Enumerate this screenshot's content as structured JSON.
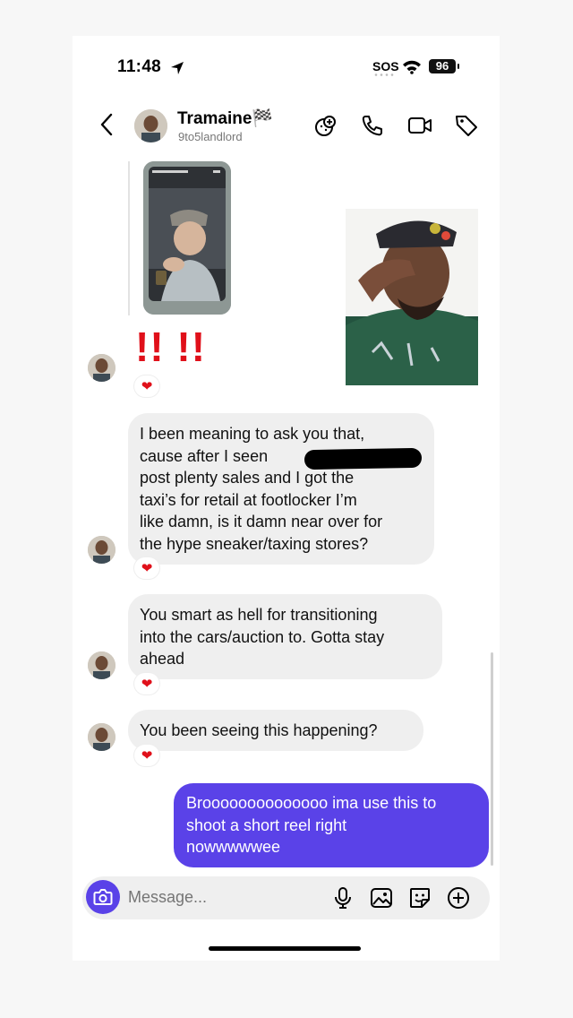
{
  "status_bar": {
    "time": "11:48",
    "sos": "SOS",
    "battery": "96"
  },
  "header": {
    "name": "Tramaine🏁",
    "username": "9to5landlord",
    "icons": [
      "back-chevron-icon",
      "call-effects-icon",
      "phone-icon",
      "video-icon",
      "tag-icon"
    ]
  },
  "thread": {
    "story_reply": {
      "caption": "",
      "media": "story-thumbnail"
    },
    "reaction_sticker": "!! !!",
    "messages": [
      {
        "sender": "them",
        "text": "I been meaning to ask you that, cause after I seen ████ post plenty sales and I got the taxi’s for retail at footlocker I’m like damn, is it damn near over for the hype sneaker/taxing stores?",
        "lines": [
          "I been meaning to ask you that,",
          "cause after I seen",
          "post plenty sales and I got the",
          "taxi’s for retail at footlocker I’m",
          "like damn, is it damn near over for",
          "the hype sneaker/taxing stores?"
        ],
        "reaction": "❤"
      },
      {
        "sender": "them",
        "lines": [
          "You smart as hell for transitioning",
          "into the cars/auction to. Gotta stay",
          "ahead"
        ],
        "reaction": "❤"
      },
      {
        "sender": "them",
        "lines": [
          "You been seeing this happening?"
        ],
        "reaction": "❤"
      },
      {
        "sender": "me",
        "lines": [
          "Broooooooooooooo ima use this to",
          "shoot a short reel right",
          "nowwwwwee"
        ]
      }
    ],
    "image_reaction": "❤"
  },
  "composer": {
    "placeholder": "Message...",
    "icons": [
      "camera-icon",
      "microphone-icon",
      "gallery-icon",
      "sticker-icon",
      "plus-icon"
    ]
  },
  "colors": {
    "accent": "#5a42e8",
    "bubble_in": "#efefef",
    "heart": "#e0101a"
  }
}
